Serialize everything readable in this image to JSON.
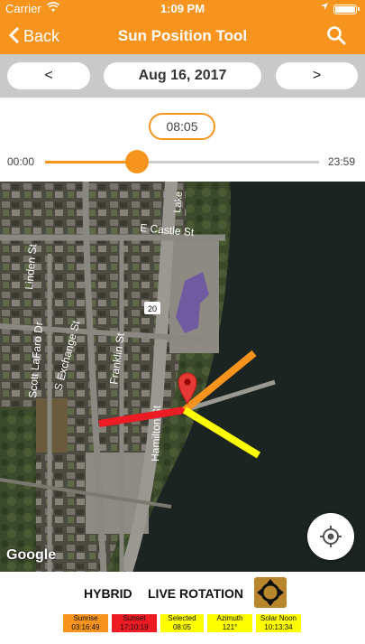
{
  "status_bar": {
    "carrier": "Carrier",
    "time": "1:09 PM"
  },
  "nav": {
    "back_label": "Back",
    "title": "Sun Position Tool"
  },
  "date_nav": {
    "prev_label": "<",
    "date": "Aug 16, 2017",
    "next_label": ">"
  },
  "time_slider": {
    "selected_time": "08:05",
    "min_label": "00:00",
    "max_label": "23:59",
    "value_fraction": 0.336
  },
  "map": {
    "attribution": "Google",
    "street_labels": [
      "Lake",
      "E Castle St",
      "Linden St",
      "Scott LaFaro Dr",
      "S Exchange St",
      "Franklin St",
      "Hamilton St",
      "20"
    ]
  },
  "bottom_bar": {
    "hybrid_label": "HYBRID",
    "live_rotation_label": "LIVE ROTATION"
  },
  "legend": [
    {
      "title": "Sunrise",
      "value": "03:16:49",
      "color": "#f7941e"
    },
    {
      "title": "Sunset",
      "value": "17:10:19",
      "color": "#ed1c24"
    },
    {
      "title": "Selected",
      "value": "08:05",
      "color": "#ffff00"
    },
    {
      "title": "Azimuth",
      "value": "121°",
      "color": "#ffff00"
    },
    {
      "title": "Solar Noon",
      "value": "10:13:34",
      "color": "#ffff00"
    }
  ],
  "colors": {
    "accent": "#f7941e",
    "sunset_line": "#ed1c24",
    "selected_line": "#ffff00",
    "sunrise_line": "#f7941e"
  }
}
